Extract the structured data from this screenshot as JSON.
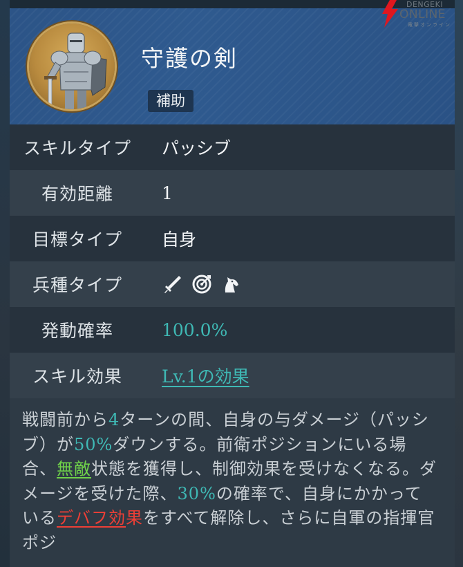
{
  "watermark": {
    "line1": "DENGEKI",
    "line2": "ONLINE",
    "line3": "電撃オンライン"
  },
  "skill": {
    "name": "守護の剣",
    "badge": "補助",
    "portrait_icon": "armored-knight-portrait"
  },
  "attributes": [
    {
      "label": "スキルタイプ",
      "value": "パッシブ"
    },
    {
      "label": "有効距離",
      "value": "1"
    },
    {
      "label": "目標タイプ",
      "value": "自身"
    },
    {
      "label": "兵種タイプ",
      "icons": [
        "sword-icon",
        "archery-target-icon",
        "cavalry-horse-icon"
      ]
    },
    {
      "label": "発動確率",
      "value": "100.0%"
    },
    {
      "label": "スキル効果",
      "value": "Lv.1の効果"
    }
  ],
  "description": {
    "p1": "戦闘前から",
    "n1": "4",
    "p2": "ターンの間、自身の与ダメージ（パッシブ）が",
    "n2": "50%",
    "p3": "ダウンする。前衛ポジションにいる場合、",
    "k1": "無敵",
    "p4": "状態を獲得し、制御効果を受けなくなる。ダメージを受けた際、",
    "n3": "30%",
    "p5": "の確率で、自身にかかっている",
    "k2a": "デバフ効",
    "k2b": "果",
    "p6": "をすべて解除し、さらに自軍の指揮官ポジ"
  },
  "colors": {
    "header_blue": "#2c5487",
    "teal_value": "#3fb9b5",
    "green_keyword": "#6fd24a",
    "red_keyword": "#ee3f36",
    "watermark_red": "#e0171f"
  }
}
